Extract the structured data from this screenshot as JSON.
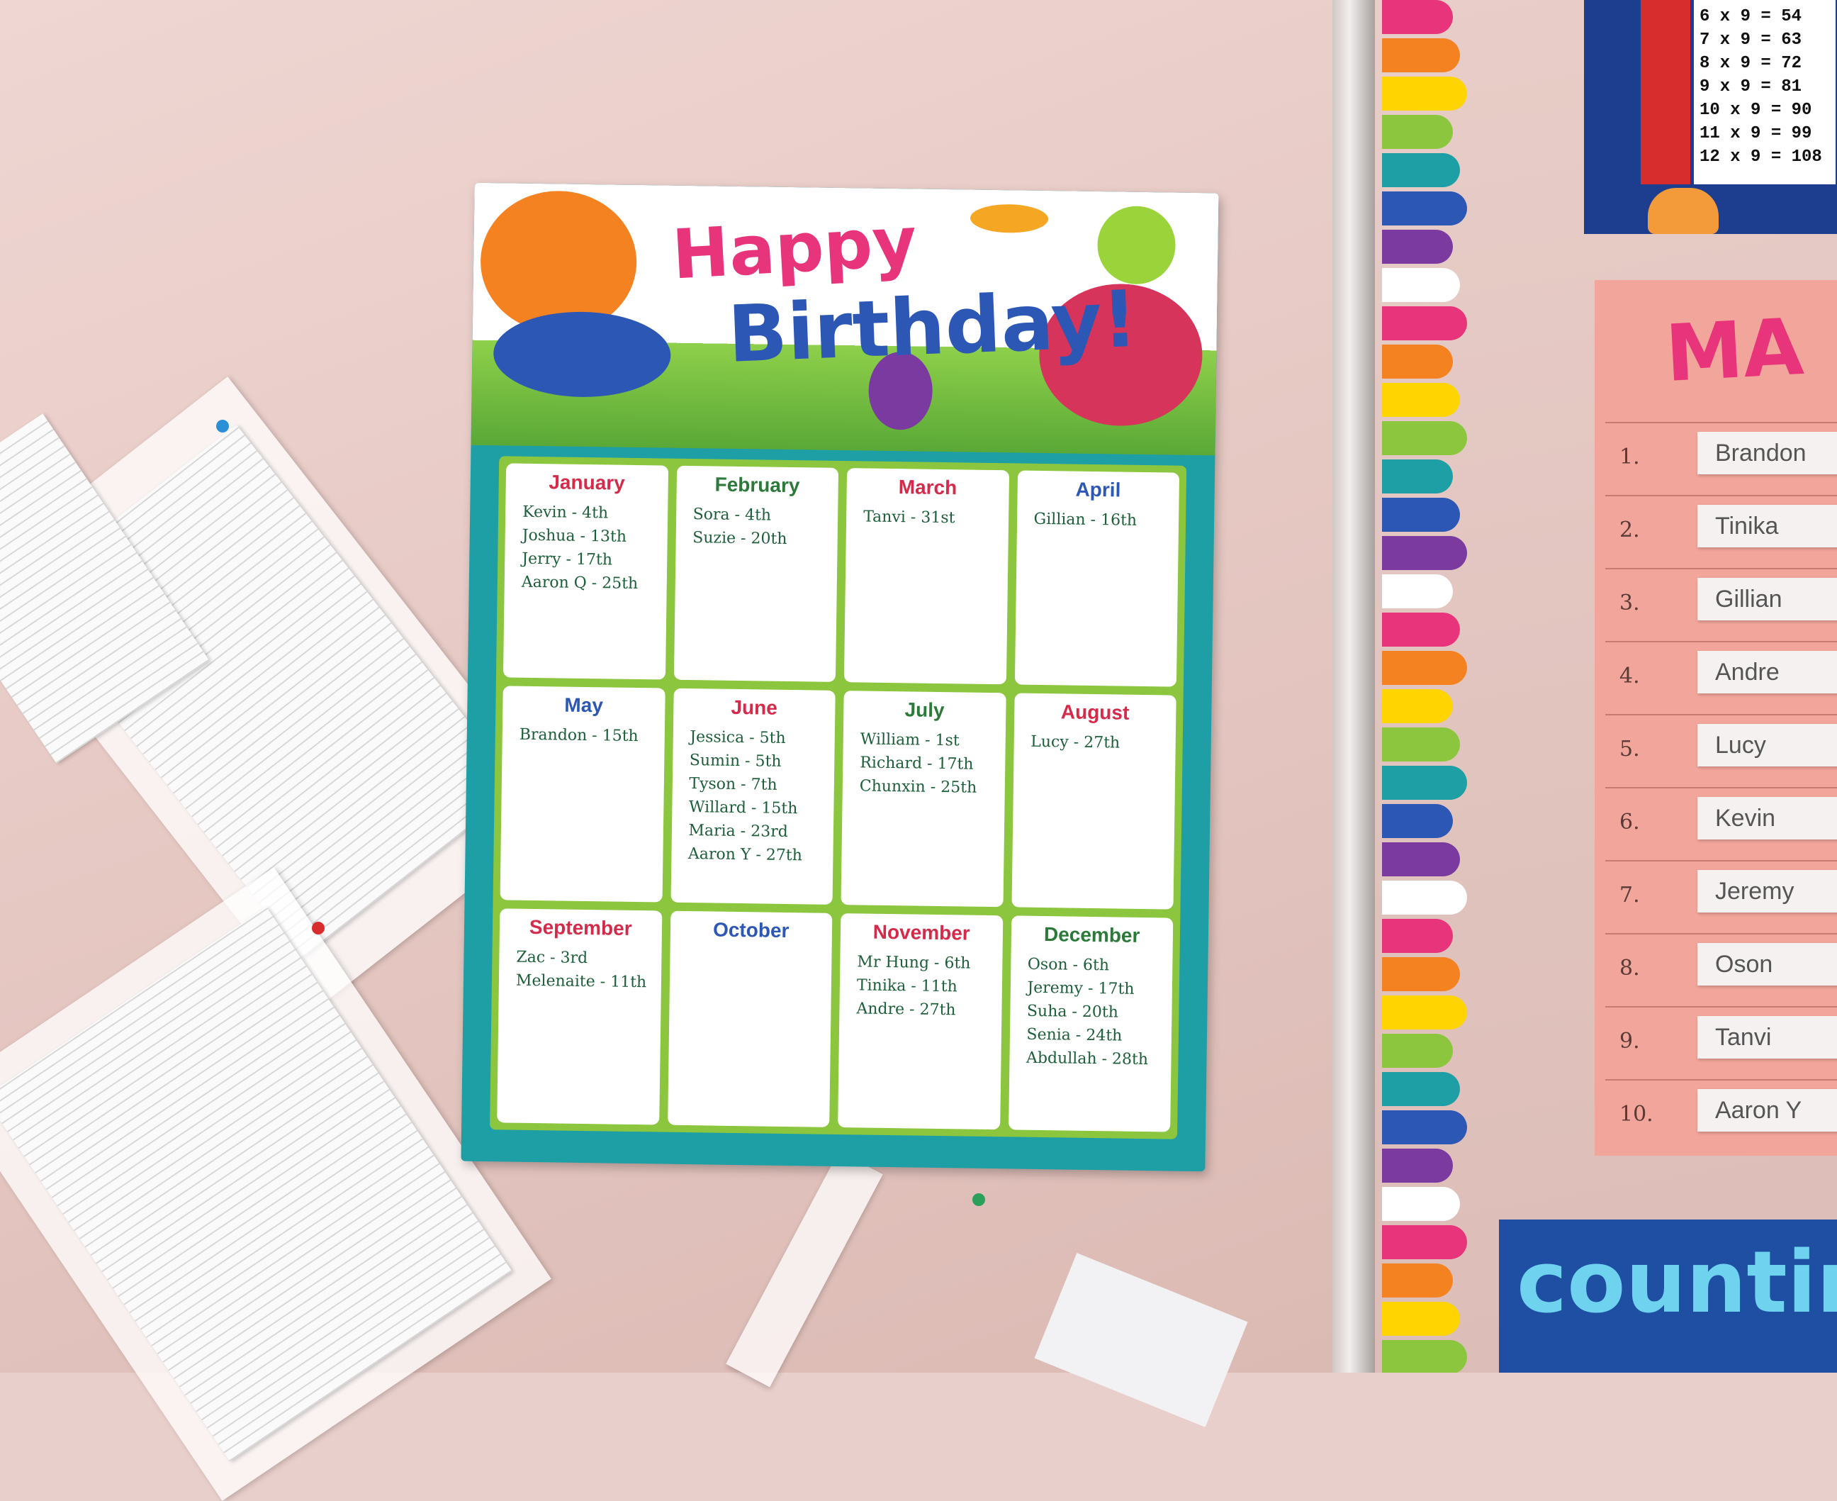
{
  "poster": {
    "title_line1": "Happy",
    "title_line2": "Birthday!",
    "months": [
      {
        "name": "January",
        "color": "#d52b4a",
        "entries": [
          "Kevin - 4th",
          "Joshua - 13th",
          "Jerry - 17th",
          "Aaron Q - 25th"
        ]
      },
      {
        "name": "February",
        "color": "#2b7a3a",
        "entries": [
          "Sora - 4th",
          "Suzie - 20th"
        ]
      },
      {
        "name": "March",
        "color": "#d52b4a",
        "entries": [
          "Tanvi - 31st"
        ]
      },
      {
        "name": "April",
        "color": "#2c57b5",
        "entries": [
          "Gillian - 16th"
        ]
      },
      {
        "name": "May",
        "color": "#2c57b5",
        "entries": [
          "Brandon - 15th"
        ]
      },
      {
        "name": "June",
        "color": "#d52b4a",
        "entries": [
          "Jessica - 5th",
          "Sumin - 5th",
          "Tyson - 7th",
          "Willard - 15th",
          "Maria - 23rd",
          "Aaron Y - 27th"
        ]
      },
      {
        "name": "July",
        "color": "#2b7a3a",
        "entries": [
          "William - 1st",
          "Richard - 17th",
          "Chunxin - 25th"
        ]
      },
      {
        "name": "August",
        "color": "#d52b4a",
        "entries": [
          "Lucy - 27th"
        ]
      },
      {
        "name": "September",
        "color": "#d52b4a",
        "entries": [
          "Zac - 3rd",
          "Melenaite - 11th"
        ]
      },
      {
        "name": "October",
        "color": "#2c57b5",
        "entries": []
      },
      {
        "name": "November",
        "color": "#d52b4a",
        "entries": [
          "Mr Hung - 6th",
          "Tinika - 11th",
          "Andre - 27th"
        ]
      },
      {
        "name": "December",
        "color": "#2b7a3a",
        "entries": [
          "Oson - 6th",
          "Jeremy - 17th",
          "Suha - 20th",
          "Senia - 24th",
          "Abdullah - 28th"
        ]
      }
    ]
  },
  "times_table": {
    "rows": [
      "6 x 9 = 54",
      "7 x 9 = 63",
      "8 x 9 = 72",
      "9 x 9 = 81",
      "10 x 9 = 90",
      "11 x 9 = 99",
      "12 x 9 = 108"
    ]
  },
  "ranking_list": {
    "title": "MA",
    "items": [
      {
        "num": "1.",
        "name": "Brandon"
      },
      {
        "num": "2.",
        "name": "Tinika"
      },
      {
        "num": "3.",
        "name": "Gillian"
      },
      {
        "num": "4.",
        "name": "Andre"
      },
      {
        "num": "5.",
        "name": "Lucy"
      },
      {
        "num": "6.",
        "name": "Kevin"
      },
      {
        "num": "7.",
        "name": "Jeremy"
      },
      {
        "num": "8.",
        "name": "Oson"
      },
      {
        "num": "9.",
        "name": "Tanvi"
      },
      {
        "num": "10.",
        "name": "Aaron Y"
      }
    ]
  },
  "counting_sign": {
    "text": "countin"
  }
}
